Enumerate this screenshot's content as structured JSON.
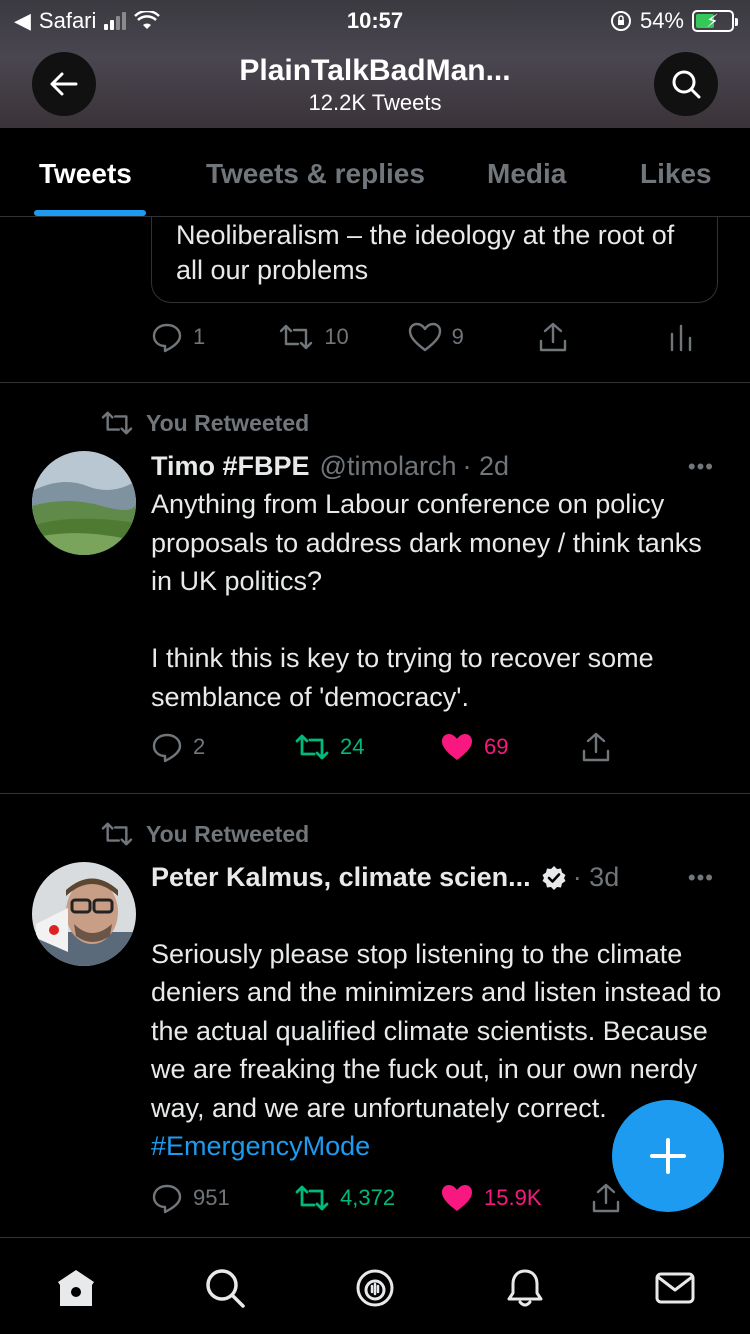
{
  "status_bar": {
    "back_app": "Safari",
    "time": "10:57",
    "battery": "54%"
  },
  "profile": {
    "name": "PlainTalkBadMan...",
    "tweet_count": "12.2K Tweets"
  },
  "tabs": [
    {
      "label": "Tweets",
      "active": true
    },
    {
      "label": "Tweets & replies",
      "active": false
    },
    {
      "label": "Media",
      "active": false
    },
    {
      "label": "Likes",
      "active": false
    }
  ],
  "quoted_card": {
    "text": "Neoliberalism – the ideology at the root of all our problems"
  },
  "first_actions": {
    "replies": "1",
    "retweets": "10",
    "likes": "9"
  },
  "tweets": [
    {
      "retweet_label": "You Retweeted",
      "name": "Timo #FBPE",
      "handle": "@timolarch",
      "time": "· 2d",
      "body": "Anything from Labour conference on policy proposals to address dark money / think tanks in UK politics?\n\nI think this is key to trying to recover some semblance of 'democracy'.",
      "replies": "2",
      "retweets": "24",
      "likes": "69"
    },
    {
      "retweet_label": "You Retweeted",
      "name": "Peter Kalmus, climate scien...",
      "handle": "",
      "time": "· 3d",
      "body": "Seriously please stop listening to the climate deniers and the minimizers and listen instead to the actual qualified climate scientists. Because we are freaking the fuck out, in our own nerdy way, and we are unfortunately correct.",
      "hashtag": "#EmergencyMode",
      "replies": "951",
      "retweets": "4,372",
      "likes": "15.9K"
    }
  ],
  "more_label": "•••",
  "colors": {
    "accent": "#1d9bf0",
    "retweet_active": "#00ba7c",
    "like_active": "#f91880",
    "muted": "#71767b"
  }
}
